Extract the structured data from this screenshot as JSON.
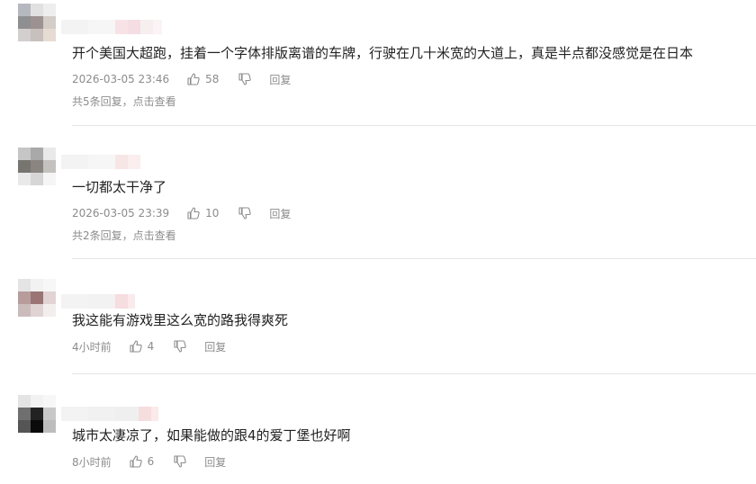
{
  "comments": [
    {
      "text": "开个美国大超跑，挂着一个字体排版离谱的车牌，行驶在几十米宽的大道上，真是半点都没感觉是在日本",
      "time": "2026-03-05 23:46",
      "likes": "58",
      "reply_label": "回复",
      "replies_link": "共5条回复，点击查看",
      "avatar_colors": [
        "#b5b8bf",
        "#e1e1e1",
        "#eeeeee",
        "#8f8f92",
        "#9c9291",
        "#d3ccc7",
        "#d4cfcf",
        "#c7c0bd",
        "#e6dcd3"
      ]
    },
    {
      "text": "一切都太干净了",
      "time": "2026-03-05 23:39",
      "likes": "10",
      "reply_label": "回复",
      "replies_link": "共2条回复，点击查看",
      "avatar_colors": [
        "#c6c6c6",
        "#a9a9a9",
        "#e9e9e9",
        "#777570",
        "#8a8580",
        "#c3c2bf",
        "#e9e9e9",
        "#d6d6d6",
        "#f5f5f5"
      ]
    },
    {
      "text": "我这能有游戏里这么宽的路我得爽死",
      "time": "4小时前",
      "likes": "4",
      "reply_label": "回复",
      "avatar_colors": [
        "#e4e4e4",
        "#f2f2f2",
        "#f7f7f7",
        "#b89c9c",
        "#9b7474",
        "#e2d4d4",
        "#cbbcbc",
        "#e0d3d3",
        "#f3eeee"
      ]
    },
    {
      "text": "城市太凄凉了，如果能做的跟4的爱丁堡也好啊",
      "time": "8小时前",
      "likes": "6",
      "reply_label": "回复",
      "avatar_colors": [
        "#e4e4e4",
        "#f2f2f2",
        "#f7f7f7",
        "#6f6f6f",
        "#222222",
        "#c8c8c8",
        "#555555",
        "#0a0a0a",
        "#bdbdbd"
      ]
    }
  ]
}
